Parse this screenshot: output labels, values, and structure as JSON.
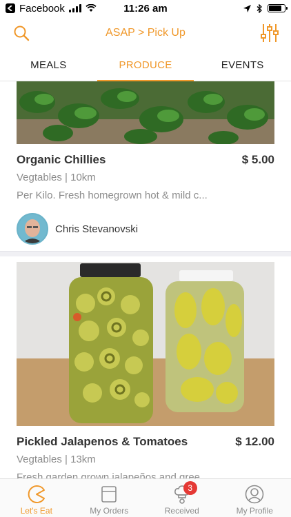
{
  "status_bar": {
    "carrier": "Facebook",
    "time": "11:26 am",
    "battery_level": 0.8
  },
  "header": {
    "title": "ASAP > Pick Up",
    "accent_color": "#f0982a"
  },
  "tabs": [
    {
      "label": "MEALS",
      "active": false
    },
    {
      "label": "PRODUCE",
      "active": true
    },
    {
      "label": "EVENTS",
      "active": false
    }
  ],
  "listings": [
    {
      "title": "Organic Chillies",
      "price": "$ 5.00",
      "meta": "Vegtables | 10km",
      "description": "Per Kilo. Fresh homegrown hot & mild c...",
      "seller": "Chris Stevanovski"
    },
    {
      "title": "Pickled Jalapenos & Tomatoes",
      "price": "$ 12.00",
      "meta": "Vegtables | 13km",
      "description": "Fresh garden grown jalapeños and gree..."
    }
  ],
  "bottom_nav": [
    {
      "label": "Let's Eat",
      "icon": "pacman-icon",
      "active": true
    },
    {
      "label": "My Orders",
      "icon": "box-icon",
      "active": false
    },
    {
      "label": "Received",
      "icon": "chef-hat-icon",
      "active": false,
      "badge": "3"
    },
    {
      "label": "My Profile",
      "icon": "user-icon",
      "active": false
    }
  ]
}
